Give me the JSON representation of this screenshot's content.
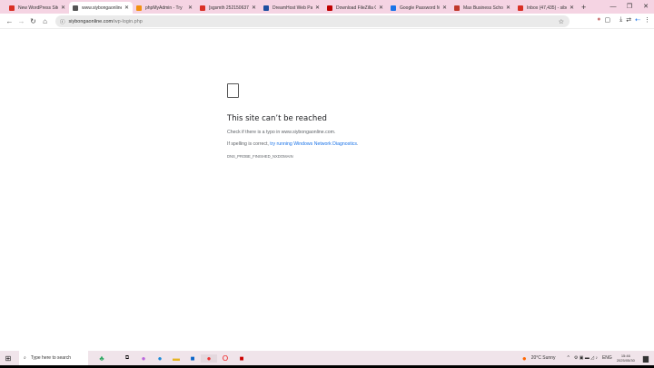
{
  "browser": {
    "tabs": [
      {
        "title": "New WordPress Site -",
        "icon": "gmail-icon",
        "color": "#d93025",
        "active": false
      },
      {
        "title": "www.siybongaonline.c",
        "icon": "globe-icon",
        "color": "#555",
        "active": true
      },
      {
        "title": "phpMyAdmin - Try",
        "icon": "phpmyadmin-icon",
        "color": "#f29111",
        "active": false
      },
      {
        "title": "[sgsmth 252150637]",
        "icon": "gmail-icon",
        "color": "#d93025",
        "active": false
      },
      {
        "title": "DreamHost Web Pan",
        "icon": "dreamhost-icon",
        "color": "#1c4fa0",
        "active": false
      },
      {
        "title": "Download FileZilla Cl",
        "icon": "filezilla-icon",
        "color": "#bf0000",
        "active": false
      },
      {
        "title": "Google Password Ma",
        "icon": "key-icon",
        "color": "#1a73e8",
        "active": false
      },
      {
        "title": "Max Business School",
        "icon": "school-icon",
        "color": "#c0392b",
        "active": false
      },
      {
        "title": "Inbox (47,435) - sibo",
        "icon": "gmail-icon",
        "color": "#d93025",
        "active": false
      }
    ],
    "url_host": "siybongaonline.com",
    "url_path": "/wp-login.php"
  },
  "error": {
    "title": "This site can’t be reached",
    "line1": "Check if there is a typo in www.siybongaonline.com.",
    "line2_prefix": "If spelling is correct, ",
    "line2_link": "try running Windows Network Diagnostics",
    "line2_suffix": ".",
    "code": "DNS_PROBE_FINISHED_NXDOMAIN"
  },
  "taskbar": {
    "search_placeholder": "Type here to search",
    "weather": "20°C  Sunny",
    "language": "ENG",
    "time": "15:46",
    "date": "2025/05/30"
  }
}
